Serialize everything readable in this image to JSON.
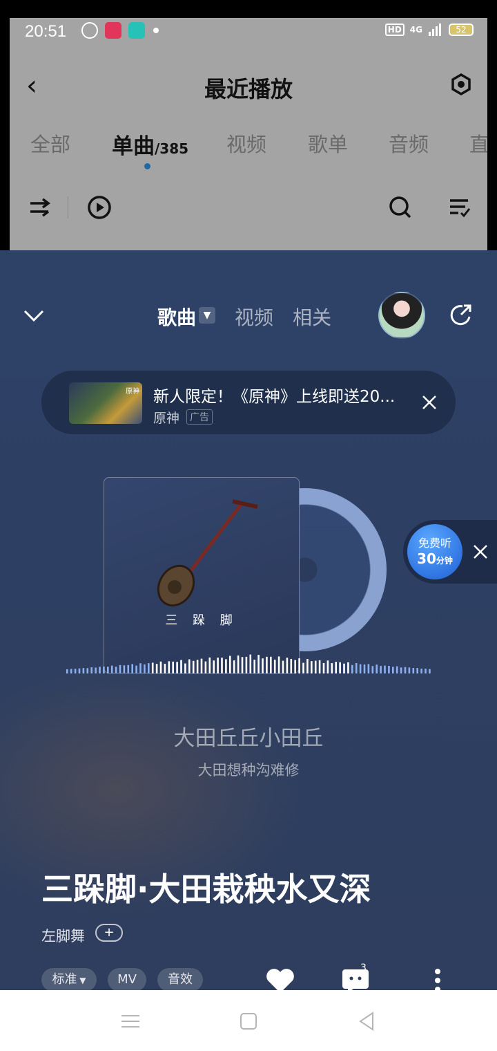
{
  "status_bar": {
    "time": "20:51",
    "hd": "HD",
    "network": "4G",
    "battery": "52"
  },
  "recent_page": {
    "title": "最近播放",
    "tabs": [
      {
        "label": "全部"
      },
      {
        "label": "单曲",
        "count": "/385"
      },
      {
        "label": "视频"
      },
      {
        "label": "歌单"
      },
      {
        "label": "音频"
      },
      {
        "label": "直"
      }
    ],
    "icons": [
      "back-icon",
      "settings-icon",
      "shuffle-icon",
      "play-all-icon",
      "search-icon",
      "manage-list-icon"
    ]
  },
  "player": {
    "tabs": {
      "song": "歌曲",
      "video": "视频",
      "related": "相关"
    },
    "ad": {
      "title": "新人限定！《原神》上线即送20...",
      "brand": "原神",
      "tag": "广告",
      "thumb_text": "原神"
    },
    "album_title": "三 跺 脚",
    "free_listen": {
      "line1": "免费听",
      "minutes": "30",
      "unit": "分钟"
    },
    "lyrics": {
      "current": "大田丘丘小田丘",
      "next": "大田想种沟难修"
    },
    "song_title": "三跺脚·大田栽秧水又深",
    "artist": "左脚舞",
    "follow_label": "+",
    "chips": {
      "quality": "标准",
      "mv": "MV",
      "effect": "音效"
    },
    "comment_count": "3"
  },
  "colors": {
    "player_bg": "#2e4268",
    "dim_overlay": "#a4a4a4",
    "accent_dot": "#1e6aa6",
    "free_badge": "#1f5fd6"
  }
}
